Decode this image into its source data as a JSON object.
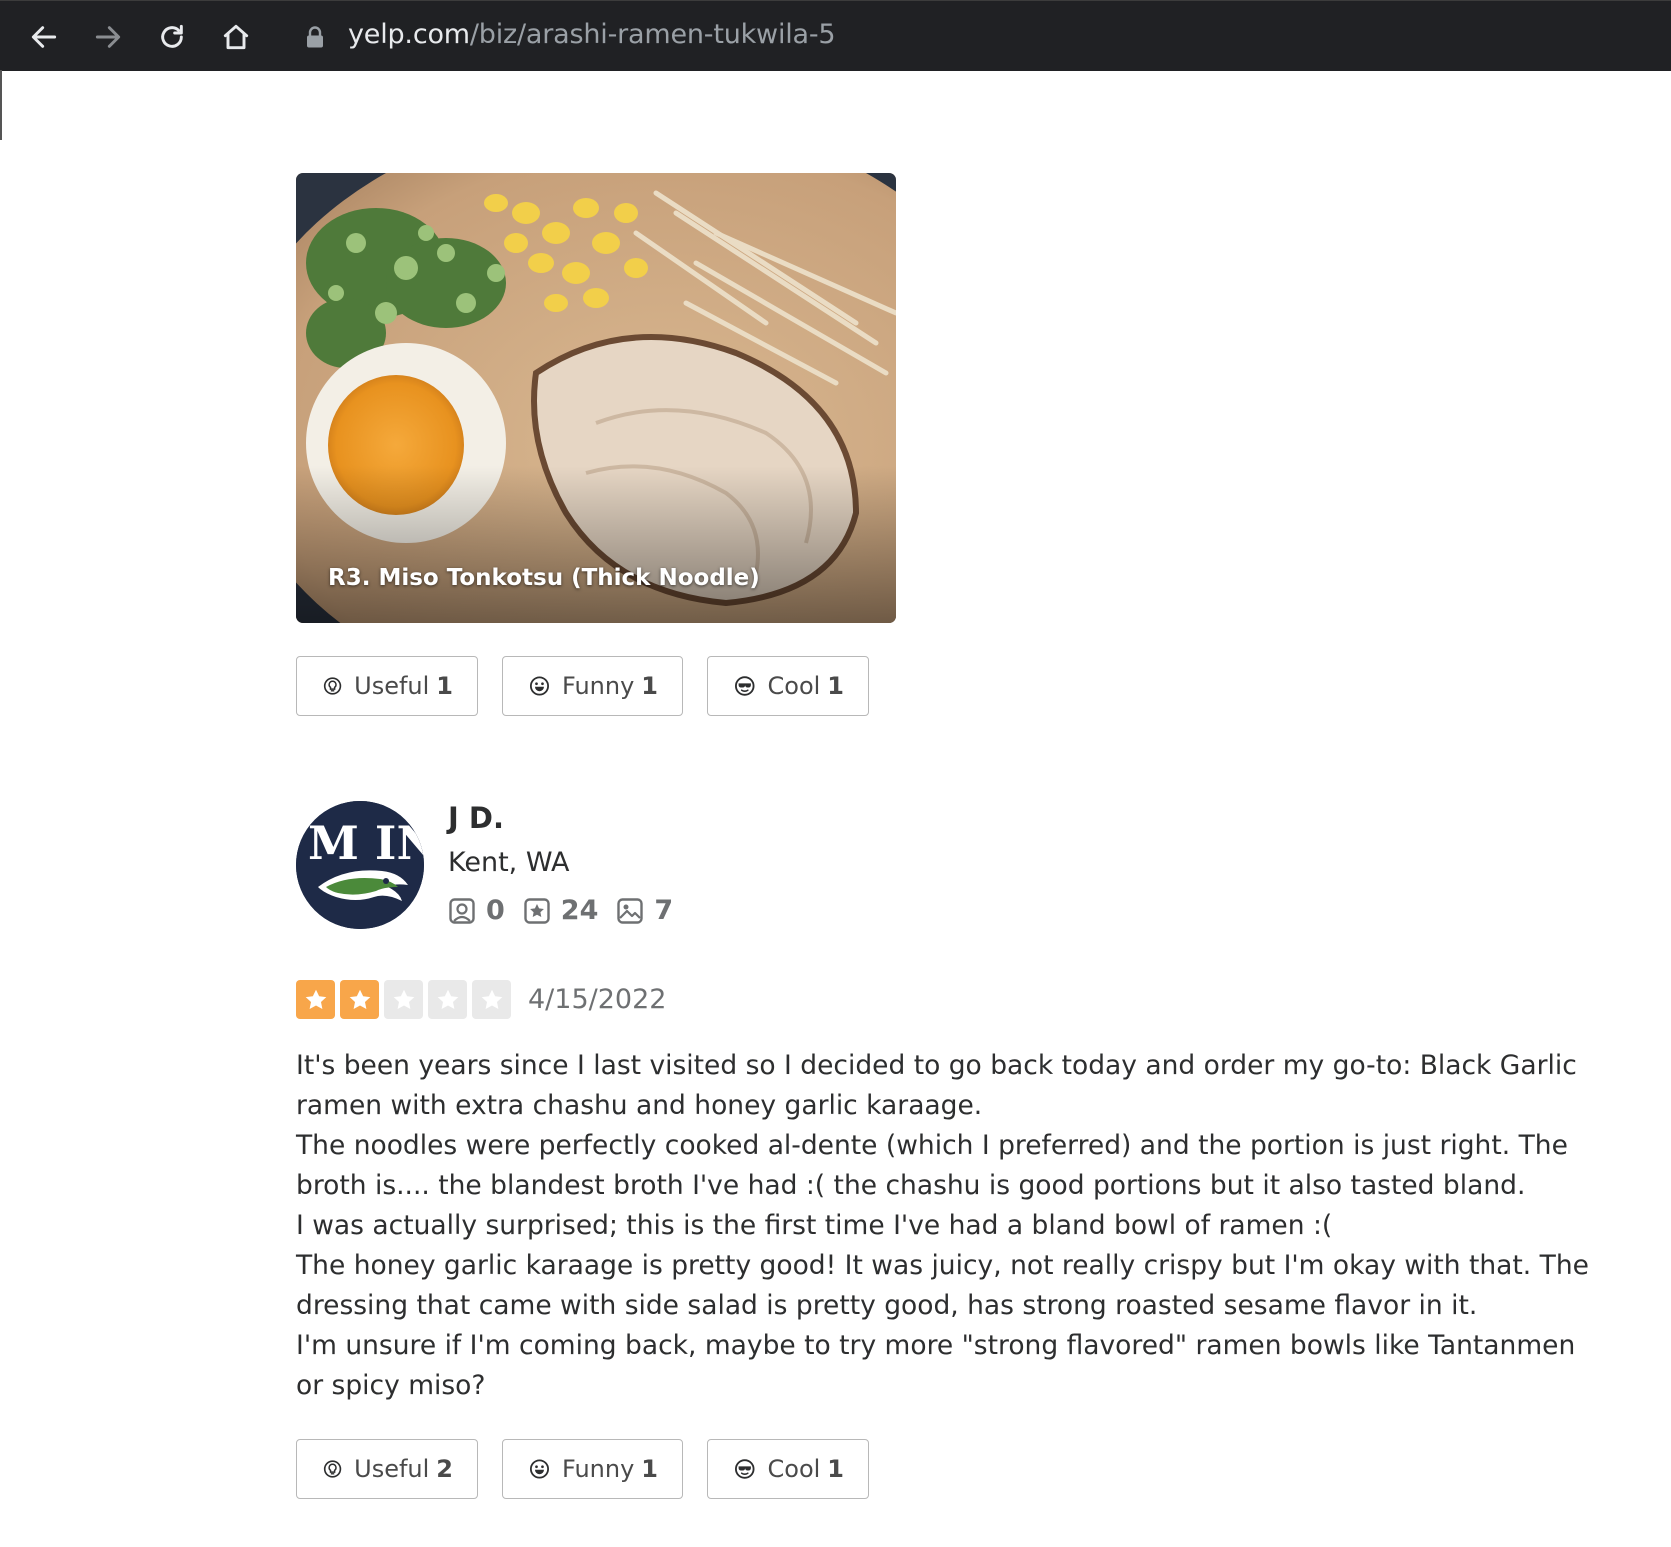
{
  "browser": {
    "url_host": "yelp.com",
    "url_path": "/biz/arashi-ramen-tukwila-5"
  },
  "photo": {
    "caption": "R3. Miso Tonkotsu (Thick Noodle)"
  },
  "previous_review_reactions": {
    "useful": {
      "label": "Useful",
      "count": "1"
    },
    "funny": {
      "label": "Funny",
      "count": "1"
    },
    "cool": {
      "label": "Cool",
      "count": "1"
    }
  },
  "review": {
    "user": {
      "name": "J D.",
      "location": "Kent, WA",
      "avatar_text": "M IN",
      "friends": "0",
      "reviews": "24",
      "photos": "7"
    },
    "rating": 2,
    "rating_max": 5,
    "date": "4/15/2022",
    "paragraphs": [
      "It's been years since I last visited so I decided to go back today and order my go-to: Black Garlic ramen with extra chashu and honey garlic karaage.",
      "The noodles were perfectly cooked al-dente (which I preferred) and the portion is just right. The broth is.... the blandest broth I've had :( the chashu is good portions but it also tasted bland.",
      "I was actually surprised; this is the first time I've had a bland bowl of ramen :(",
      "The honey garlic karaage is pretty good! It was juicy, not really crispy but I'm okay with that. The dressing that came with side salad is pretty good, has strong roasted sesame flavor in it.",
      "I'm unsure if I'm coming back, maybe to try more \"strong flavored\" ramen bowls like Tantanmen or spicy miso?"
    ],
    "reactions": {
      "useful": {
        "label": "Useful",
        "count": "2"
      },
      "funny": {
        "label": "Funny",
        "count": "1"
      },
      "cool": {
        "label": "Cool",
        "count": "1"
      }
    }
  },
  "colors": {
    "star_filled": "#f8a64a",
    "star_empty": "#e9e9e9",
    "chrome_bg": "#202124"
  },
  "icons": [
    "back-arrow-icon",
    "forward-arrow-icon",
    "reload-icon",
    "home-icon",
    "lock-icon",
    "useful-icon",
    "funny-icon",
    "cool-icon",
    "friends-icon",
    "review-star-icon",
    "photo-icon",
    "star-icon"
  ]
}
